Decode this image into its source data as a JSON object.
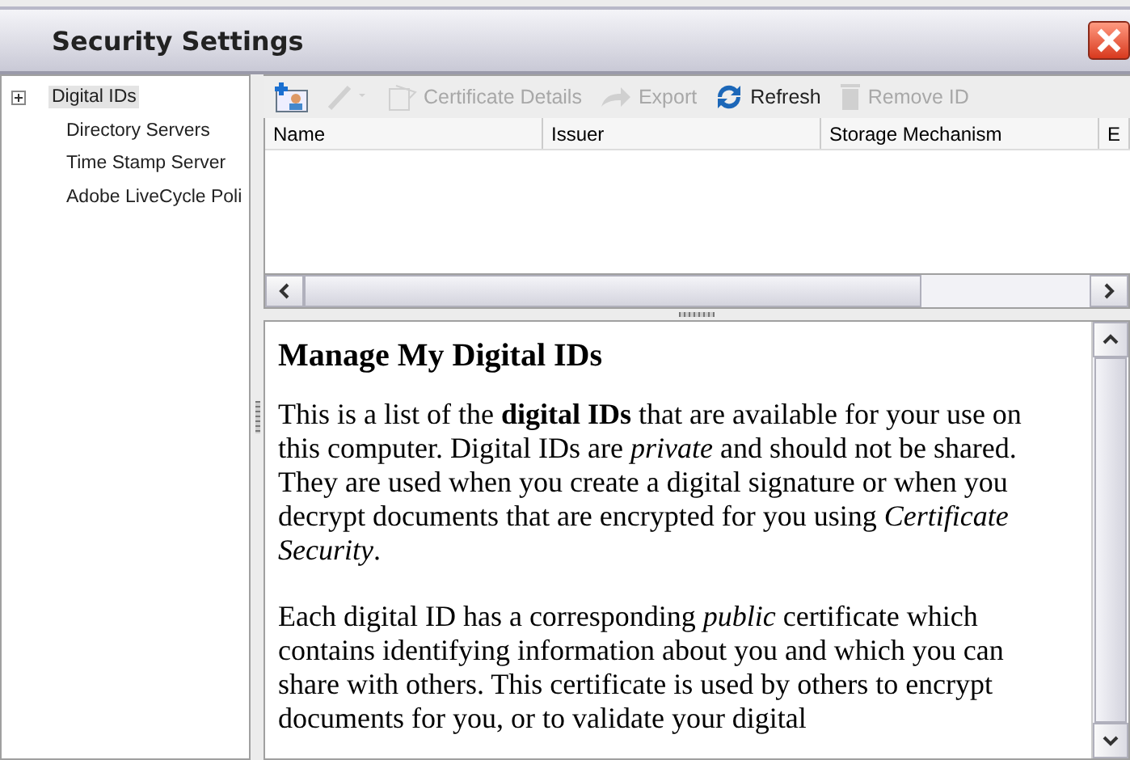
{
  "window": {
    "title": "Security Settings"
  },
  "sidebar": {
    "items": [
      {
        "label": "Digital IDs",
        "selected": true,
        "expandable": true
      },
      {
        "label": "Directory Servers",
        "selected": false,
        "expandable": false
      },
      {
        "label": "Time Stamp Server",
        "selected": false,
        "expandable": false
      },
      {
        "label": "Adobe LiveCycle Poli",
        "selected": false,
        "expandable": false
      }
    ]
  },
  "toolbar": [
    {
      "kind": "add",
      "disabled": false
    },
    {
      "kind": "edit",
      "disabled": true
    },
    {
      "kind": "certificate",
      "label": "Certificate Details",
      "disabled": true
    },
    {
      "kind": "export",
      "label": "Export",
      "disabled": true
    },
    {
      "kind": "refresh",
      "label": "Refresh",
      "disabled": false
    },
    {
      "kind": "remove",
      "label": "Remove ID",
      "disabled": true
    }
  ],
  "table": {
    "columns": [
      "Name",
      "Issuer",
      "Storage Mechanism",
      "E"
    ]
  },
  "document": {
    "heading": "Manage My Digital IDs",
    "paragraphs": [
      "This is a list of the **digital IDs** that are available for your use on this computer. Digital IDs are *private* and should not be shared. They are used when you create a digital signature or when you decrypt documents that are encrypted for you using *Certificate Security*.",
      "Each digital ID has a corresponding *public* certificate which contains identifying information about you and which you can share with others. This certificate is used by others to encrypt documents for you, or to validate your digital"
    ]
  }
}
